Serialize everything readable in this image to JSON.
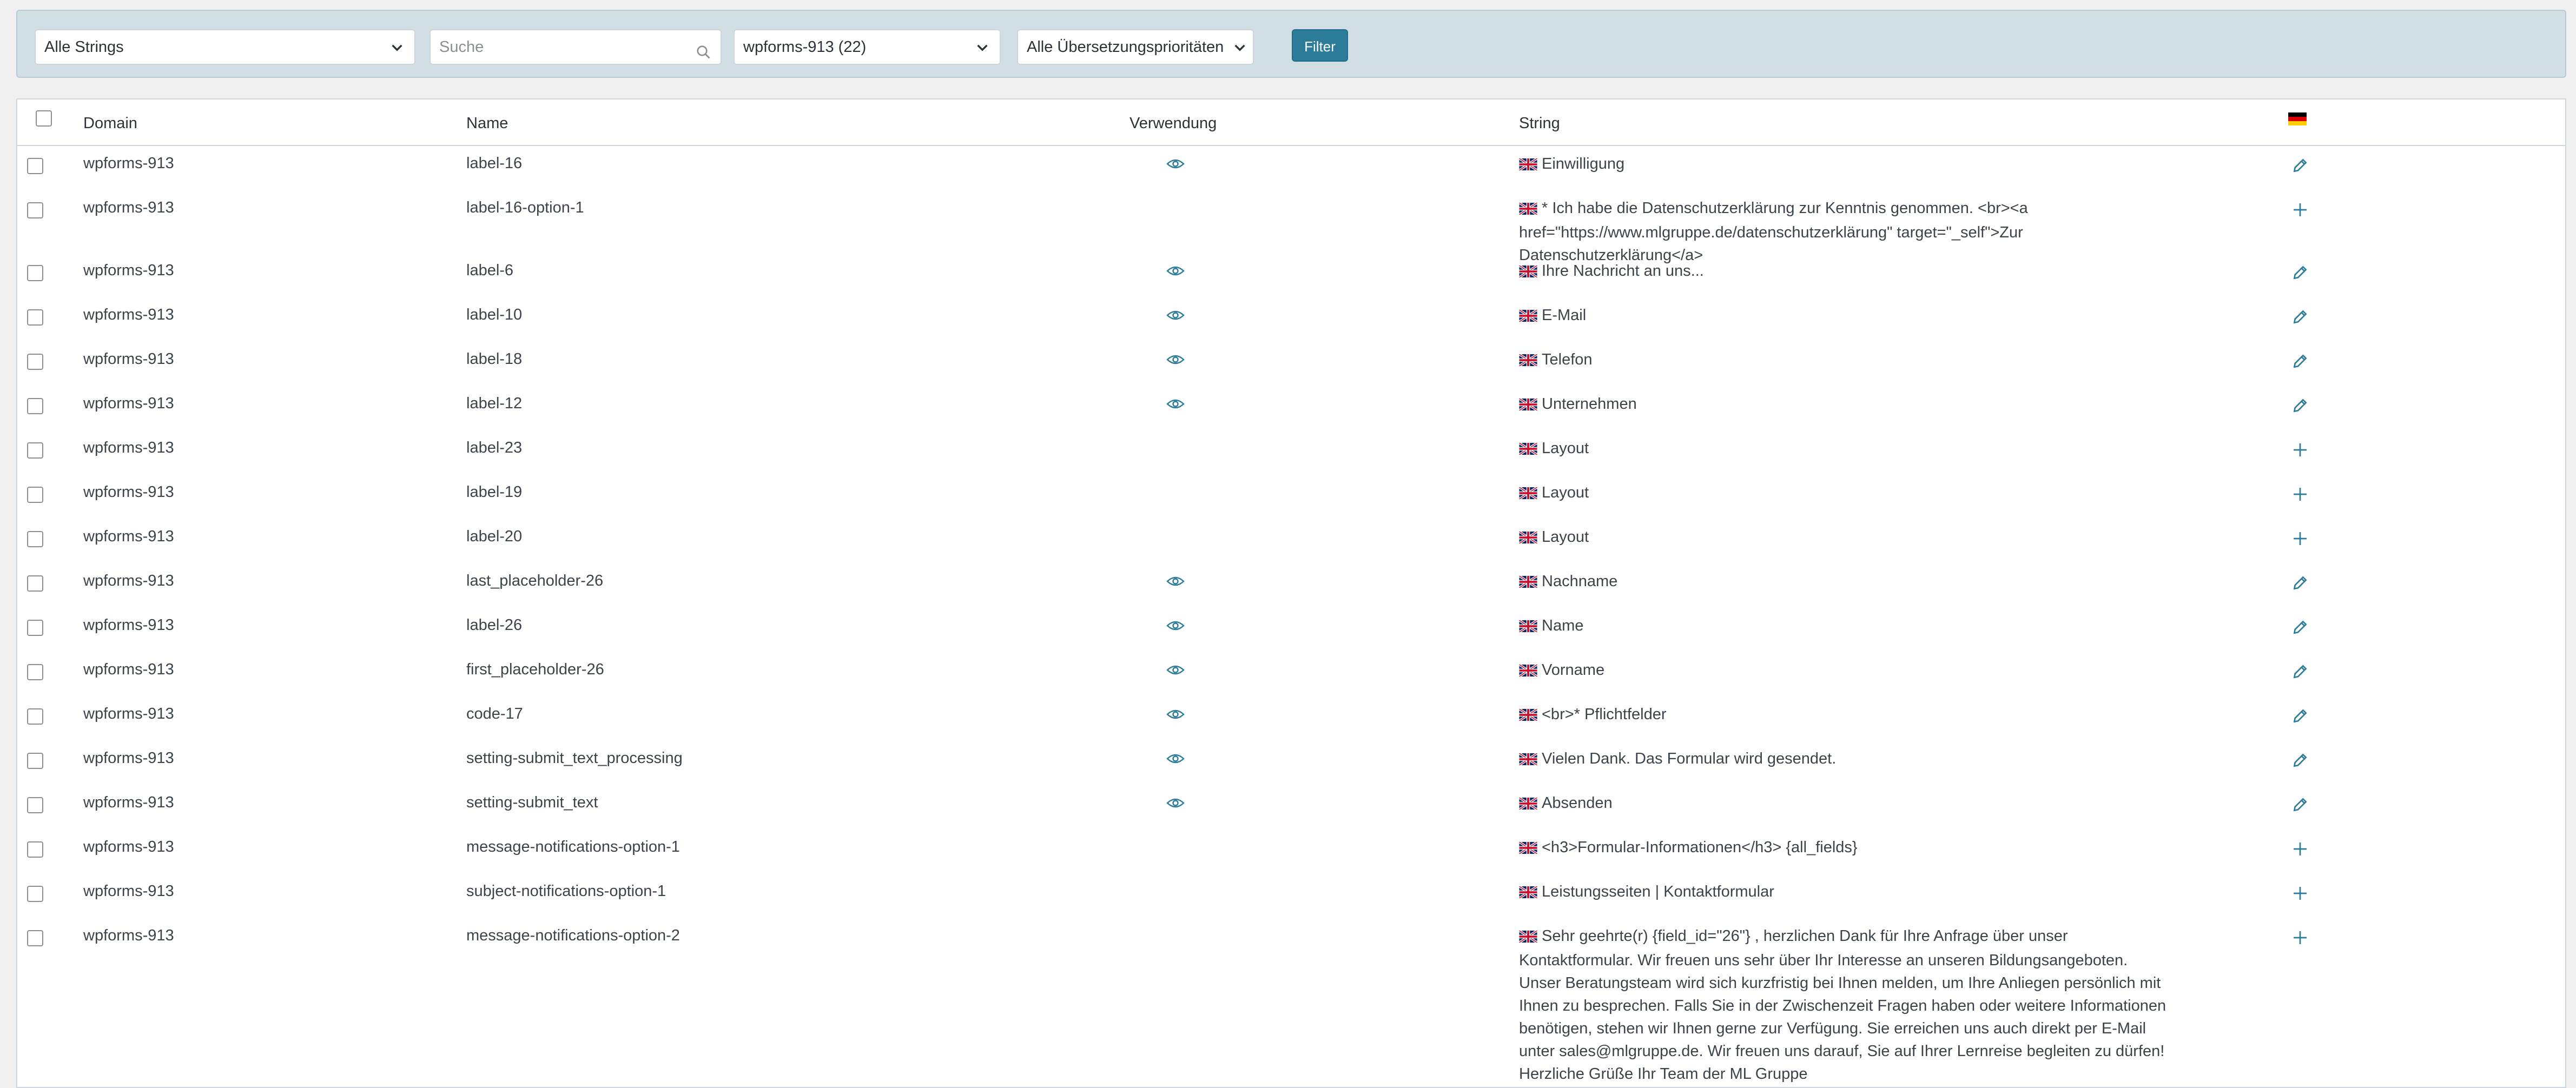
{
  "filters": {
    "strings_select": "Alle Strings",
    "search_placeholder": "Suche",
    "domain_select": "wpforms-913 (22)",
    "priority_select": "Alle Übersetzungsprioritäten",
    "filter_button": "Filter"
  },
  "table": {
    "headers": {
      "domain": "Domain",
      "name": "Name",
      "usage": "Verwendung",
      "string": "String"
    },
    "target_language": "de",
    "rows": [
      {
        "domain": "wpforms-913",
        "name": "label-16",
        "string": "Einwilligung",
        "has_usage": true,
        "action": "edit"
      },
      {
        "domain": "wpforms-913",
        "name": "label-16-option-1",
        "string": "* Ich habe die Datenschutzerklärung zur Kenntnis genommen. <br><a href=\"https://www.mlgruppe.de/datenschutzerklärung\" target=\"_self\">Zur Datenschutzerklärung</a>",
        "has_usage": false,
        "action": "add"
      },
      {
        "domain": "wpforms-913",
        "name": "label-6",
        "string": "Ihre Nachricht an uns...",
        "has_usage": true,
        "action": "edit"
      },
      {
        "domain": "wpforms-913",
        "name": "label-10",
        "string": "E-Mail",
        "has_usage": true,
        "action": "edit"
      },
      {
        "domain": "wpforms-913",
        "name": "label-18",
        "string": "Telefon",
        "has_usage": true,
        "action": "edit"
      },
      {
        "domain": "wpforms-913",
        "name": "label-12",
        "string": "Unternehmen",
        "has_usage": true,
        "action": "edit"
      },
      {
        "domain": "wpforms-913",
        "name": "label-23",
        "string": "Layout",
        "has_usage": false,
        "action": "add"
      },
      {
        "domain": "wpforms-913",
        "name": "label-19",
        "string": "Layout",
        "has_usage": false,
        "action": "add"
      },
      {
        "domain": "wpforms-913",
        "name": "label-20",
        "string": "Layout",
        "has_usage": false,
        "action": "add"
      },
      {
        "domain": "wpforms-913",
        "name": "last_placeholder-26",
        "string": "Nachname",
        "has_usage": true,
        "action": "edit"
      },
      {
        "domain": "wpforms-913",
        "name": "label-26",
        "string": "Name",
        "has_usage": true,
        "action": "edit"
      },
      {
        "domain": "wpforms-913",
        "name": "first_placeholder-26",
        "string": "Vorname",
        "has_usage": true,
        "action": "edit"
      },
      {
        "domain": "wpforms-913",
        "name": "code-17",
        "string": "<br>* Pflichtfelder",
        "has_usage": true,
        "action": "edit"
      },
      {
        "domain": "wpforms-913",
        "name": "setting-submit_text_processing",
        "string": "Vielen Dank. Das Formular wird gesendet.",
        "has_usage": true,
        "action": "edit"
      },
      {
        "domain": "wpforms-913",
        "name": "setting-submit_text",
        "string": "Absenden",
        "has_usage": true,
        "action": "edit"
      },
      {
        "domain": "wpforms-913",
        "name": "message-notifications-option-1",
        "string": "<h3>Formular-Informationen</h3> {all_fields}",
        "has_usage": false,
        "action": "add"
      },
      {
        "domain": "wpforms-913",
        "name": "subject-notifications-option-1",
        "string": "Leistungsseiten | Kontaktformular",
        "has_usage": false,
        "action": "add"
      },
      {
        "domain": "wpforms-913",
        "name": "message-notifications-option-2",
        "string": "Sehr geehrte(r) {field_id=\"26\"} , herzlichen Dank für Ihre Anfrage über unser Kontaktformular. Wir freuen uns sehr über Ihr Interesse an unseren Bildungsangeboten. Unser Beratungsteam wird sich kurzfristig bei Ihnen melden, um Ihre Anliegen persönlich mit Ihnen zu besprechen. Falls Sie in der Zwischenzeit Fragen haben oder weitere Informationen benötigen, stehen wir Ihnen gerne zur Verfügung. Sie erreichen uns auch direkt per E-Mail unter sales@mlgruppe.de. Wir freuen uns darauf, Sie auf Ihrer Lernreise begleiten zu dürfen! Herzliche Grüße Ihr Team der ML Gruppe",
        "has_usage": false,
        "action": "add"
      }
    ]
  }
}
